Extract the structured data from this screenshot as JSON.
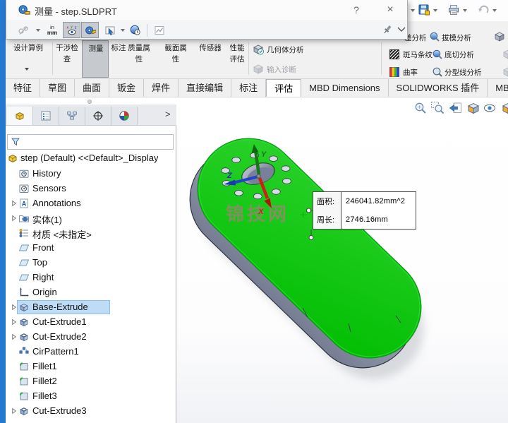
{
  "measure_dialog": {
    "title": "测量 - step.SLDPRT",
    "help_label": "?",
    "close_label": "×",
    "units": {
      "top": "in",
      "bottom": "mm"
    }
  },
  "ribbon": {
    "design_study": "设计算例",
    "interference_check": "干涉检查",
    "measure": "测量",
    "markup": "标注",
    "mass_properties": "质量属性",
    "section_properties": "截面属性",
    "sensors": "传感器",
    "performance_evaluation": "性能评估",
    "geometry_analysis": "几何体分析",
    "import_diagnostics": "输入诊断",
    "tolerance_analysis": "差分析",
    "draft_analysis": "拔模分析",
    "zebra_stripes": "斑马条纹",
    "undercut_analysis": "底切分析",
    "curvature": "曲率",
    "parting_line_analysis": "分型线分析"
  },
  "tabs": {
    "active": "评估",
    "items": [
      "特征",
      "草图",
      "曲面",
      "钣金",
      "焊件",
      "直接编辑",
      "标注",
      "评估",
      "MBD Dimensions",
      "SOLIDWORKS 插件",
      "MBD"
    ]
  },
  "feature_tree": {
    "root": "step (Default) <<Default>_Display",
    "items": [
      {
        "label": "History"
      },
      {
        "label": "Sensors"
      },
      {
        "label": "Annotations"
      },
      {
        "label": "实体(1)"
      },
      {
        "label": "材质 <未指定>"
      },
      {
        "label": "Front"
      },
      {
        "label": "Top"
      },
      {
        "label": "Right"
      },
      {
        "label": "Origin"
      },
      {
        "label": "Base-Extrude"
      },
      {
        "label": "Cut-Extrude1"
      },
      {
        "label": "Cut-Extrude2"
      },
      {
        "label": "CirPattern1"
      },
      {
        "label": "Fillet1"
      },
      {
        "label": "Fillet2"
      },
      {
        "label": "Fillet3"
      },
      {
        "label": "Cut-Extrude3"
      }
    ]
  },
  "panel": {
    "overflow_chevron": ">"
  },
  "viewport": {
    "watermark": "锦技网",
    "triad": {
      "x": "X",
      "y": "Y",
      "z": "Z"
    },
    "callout": {
      "area_label": "面积:",
      "area_value": "246041.82mm^2",
      "perimeter_label": "周长:",
      "perimeter_value": "2746.16mm"
    }
  },
  "colors": {
    "accent_blue": "#2379d0",
    "selection_fill": "#bfdcf7",
    "face_green": "#02c202",
    "side_gray": "#9aa0b3",
    "watermark_pink": "#e060a0",
    "rollback_blue": "#2b7cd6"
  }
}
